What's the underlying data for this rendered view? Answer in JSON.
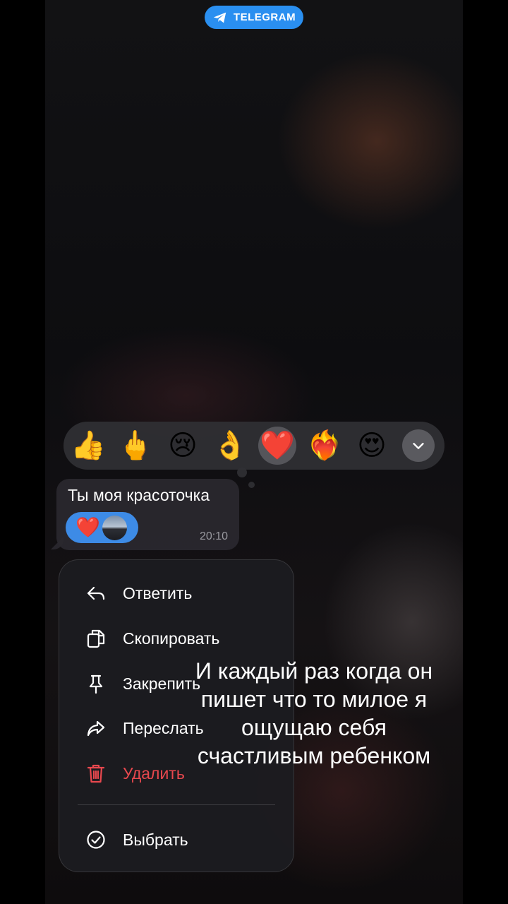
{
  "badge": {
    "label": "TELEGRAM",
    "color": "#2a8ff0"
  },
  "reactions": {
    "items": [
      "👍",
      "🖕",
      "😢",
      "👌",
      "❤️",
      "❤️‍🔥",
      "😍"
    ],
    "selected_index": 4,
    "expand_icon": "chevron-down-icon"
  },
  "message": {
    "text": "Ты моя красоточка",
    "reaction_emoji": "❤️",
    "time": "20:10"
  },
  "context_menu": {
    "items": [
      {
        "label": "Ответить",
        "icon": "reply-icon"
      },
      {
        "label": "Скопировать",
        "icon": "copy-icon"
      },
      {
        "label": "Закрепить",
        "icon": "pin-icon"
      },
      {
        "label": "Переслать",
        "icon": "forward-icon"
      },
      {
        "label": "Удалить",
        "icon": "trash-icon",
        "destructive": true
      }
    ],
    "select_label": "Выбрать",
    "select_icon": "check-circle-icon",
    "danger_color": "#e8484e"
  },
  "overlay_text": {
    "lines": [
      "И каждый раз когда он",
      "пишет что то милое я",
      "ощущаю себя",
      "счастливым ребенком"
    ]
  }
}
